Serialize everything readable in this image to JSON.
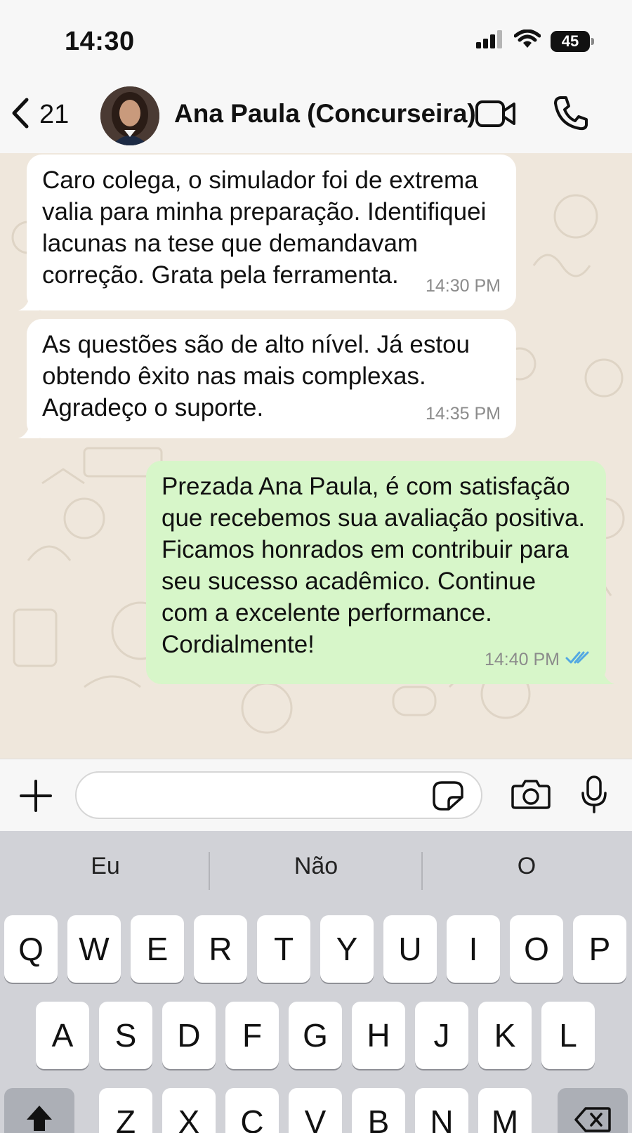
{
  "status_bar": {
    "time": "14:30",
    "battery": "45",
    "icons": [
      "signal-icon",
      "wifi-icon",
      "battery-icon"
    ]
  },
  "header": {
    "back_count": "21",
    "contact_name": "Ana Paula (Concurseira)",
    "icons": [
      "chevron-left-icon",
      "video-camera-icon",
      "phone-icon"
    ]
  },
  "messages": [
    {
      "direction": "incoming",
      "lines": [
        "Caro colega, o simulador foi de extrema",
        "valia para minha preparação. Identifiquei",
        "lacunas na tese que demandavam",
        "correção. Grata pela ferramenta."
      ],
      "time": "14:30 PM"
    },
    {
      "direction": "incoming",
      "lines": [
        "As questões são de alto nível. Já estou",
        "obtendo êxito nas mais complexas.",
        "Agradeço o suporte."
      ],
      "time": "14:35 PM"
    },
    {
      "direction": "outgoing",
      "lines": [
        "Prezada Ana Paula, é com satisfação",
        "que recebemos sua avaliação positiva.",
        "Ficamos honrados em contribuir para",
        "seu sucesso acadêmico. Continue",
        "com a excelente performance.",
        "Cordialmente!"
      ],
      "time": "14:40 PM",
      "status": "read"
    }
  ],
  "composer": {
    "input_value": "",
    "icons": [
      "plus-icon",
      "sticker-icon",
      "camera-icon",
      "microphone-icon"
    ]
  },
  "keyboard": {
    "suggestions": [
      "Eu",
      "Não",
      "O"
    ],
    "row1": [
      "Q",
      "W",
      "E",
      "R",
      "T",
      "Y",
      "U",
      "I",
      "O",
      "P"
    ],
    "row2": [
      "A",
      "S",
      "D",
      "F",
      "G",
      "H",
      "J",
      "K",
      "L"
    ],
    "row3": [
      "Z",
      "X",
      "C",
      "V",
      "B",
      "N",
      "M"
    ]
  },
  "colors": {
    "chat_background": "#efe7dc",
    "incoming_bubble": "#ffffff",
    "outgoing_bubble": "#d7f6c9",
    "read_ticks": "#53a8e2",
    "keyboard_background": "#d1d2d7"
  }
}
